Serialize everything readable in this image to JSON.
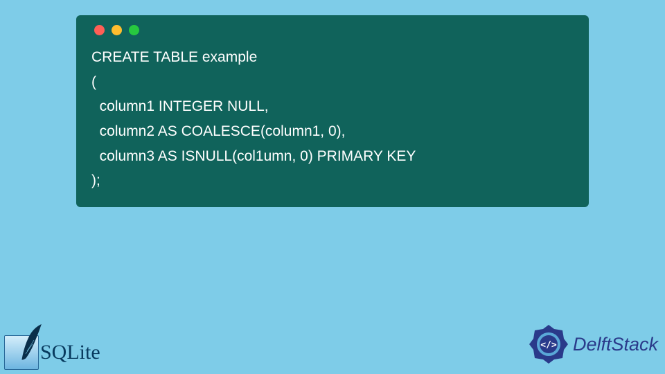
{
  "code": {
    "line1": "CREATE TABLE example",
    "line2": "(",
    "line3": "  column1 INTEGER NULL,",
    "line4": "  column2 AS COALESCE(column1, 0),",
    "line5": "  column3 AS ISNULL(col1umn, 0) PRIMARY KEY",
    "line6": ");"
  },
  "logos": {
    "sqlite": "SQLite",
    "delftstack": "DelftStack"
  },
  "colors": {
    "background": "#7ecce8",
    "code_bg": "#10635b",
    "code_fg": "#ffffff",
    "dot_red": "#ff5f56",
    "dot_yellow": "#ffbd2e",
    "dot_green": "#27c93f"
  }
}
